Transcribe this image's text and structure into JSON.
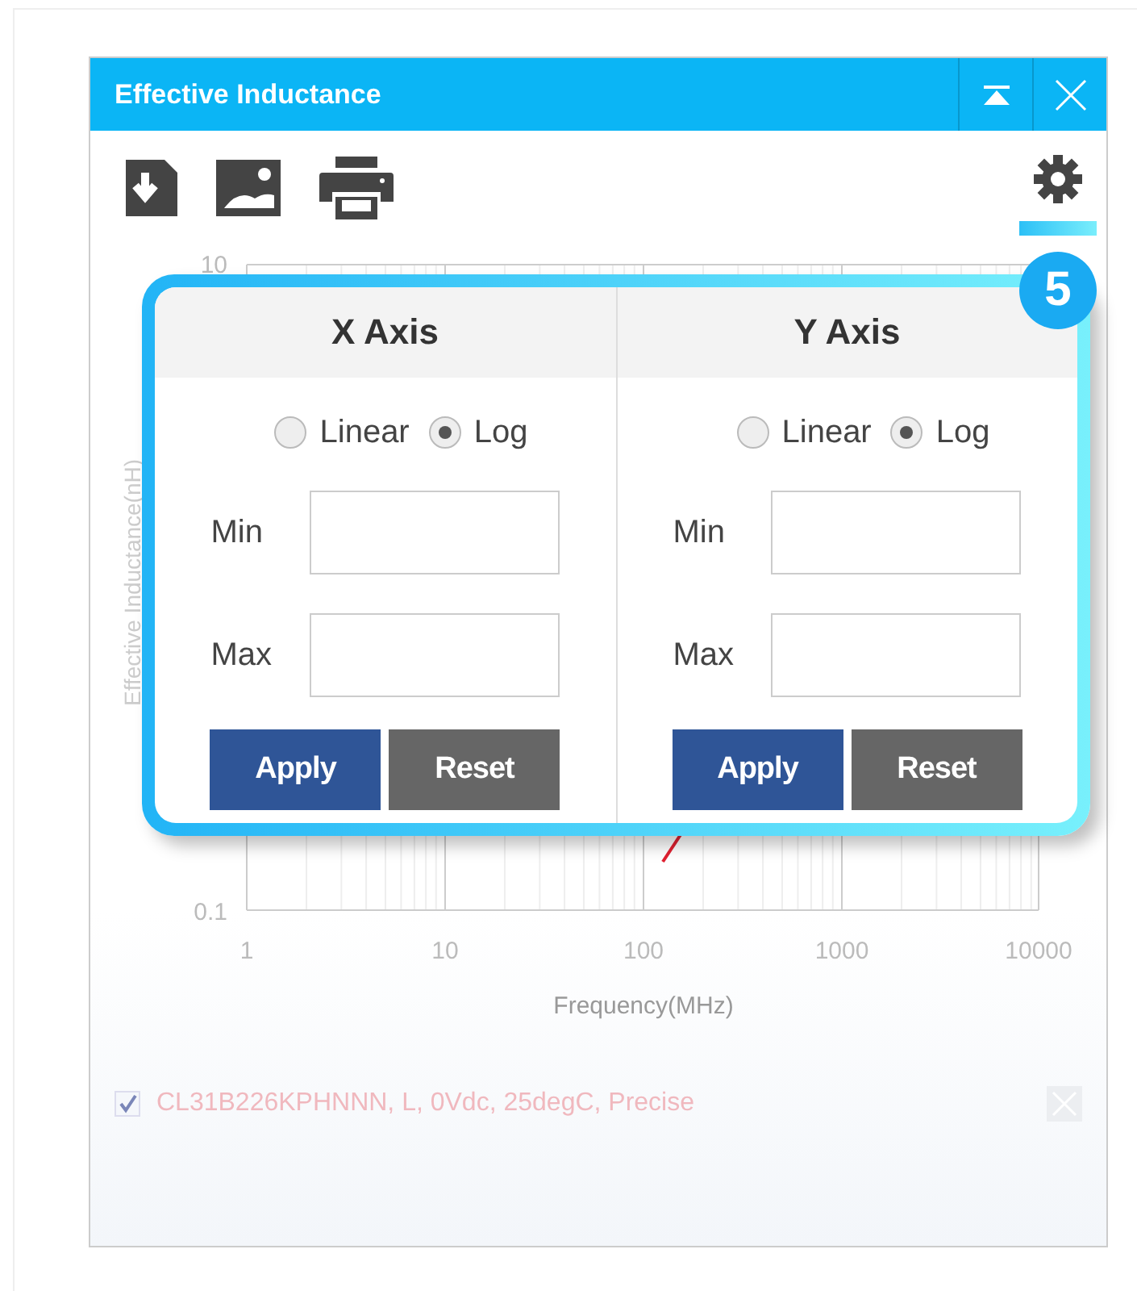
{
  "window": {
    "title": "Effective Inductance"
  },
  "chart": {
    "y_label": "Effective Inductance(nH)",
    "y_ticks": [
      "10",
      "0.1"
    ],
    "x_ticks": [
      "1",
      "10",
      "100",
      "1000",
      "10000"
    ],
    "x_label": "Frequency(MHz)"
  },
  "callout": {
    "number": "5"
  },
  "axis_panels": [
    {
      "title": "X Axis",
      "scales": [
        {
          "label": "Linear",
          "selected": false
        },
        {
          "label": "Log",
          "selected": true
        }
      ],
      "fields": [
        {
          "label": "Min"
        },
        {
          "label": "Max"
        }
      ],
      "buttons": [
        {
          "label": "Apply",
          "kind": "primary"
        },
        {
          "label": "Reset",
          "kind": "secondary"
        }
      ]
    },
    {
      "title": "Y Axis",
      "scales": [
        {
          "label": "Linear",
          "selected": false
        },
        {
          "label": "Log",
          "selected": true
        }
      ],
      "fields": [
        {
          "label": "Min"
        },
        {
          "label": "Max"
        }
      ],
      "buttons": [
        {
          "label": "Apply",
          "kind": "primary"
        },
        {
          "label": "Reset",
          "kind": "secondary"
        }
      ]
    }
  ],
  "legend": [
    {
      "label": "CL31B226KPHNNN, L, 0Vdc, 25degC, Precise",
      "checked": true,
      "color": "#f0b8be"
    }
  ]
}
